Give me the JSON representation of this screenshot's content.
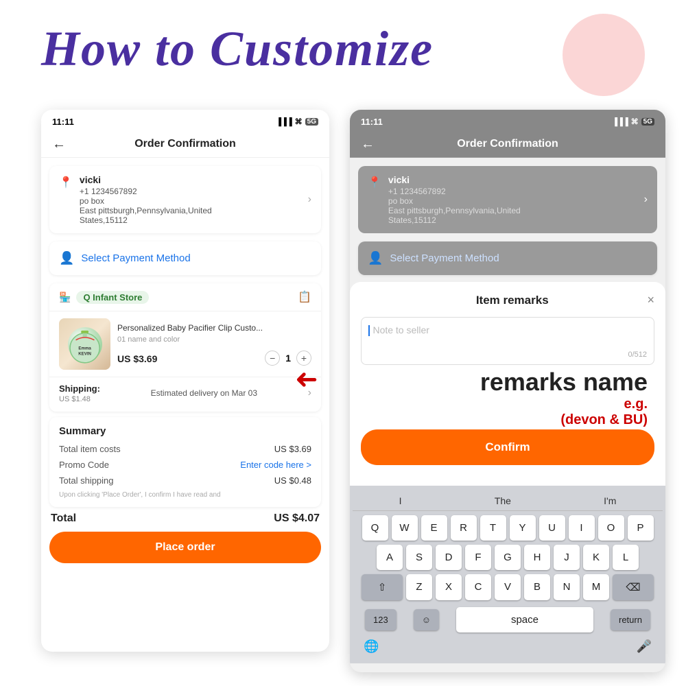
{
  "title": "How to Customize",
  "decorations": {
    "circle_pink": "pink circle",
    "circle_green": "green circle"
  },
  "left_phone": {
    "status_bar": {
      "time": "11:11",
      "signal": "signal-icon",
      "wifi": "wifi-icon",
      "network": "5G"
    },
    "header": {
      "back_label": "←",
      "title": "Order Confirmation"
    },
    "address": {
      "name": "vicki",
      "phone": "+1 1234567892",
      "address1": "po box",
      "address2": "East pittsburgh,Pennsylvania,United",
      "address3": "States,15112"
    },
    "payment": {
      "label": "Select Payment Method"
    },
    "store": {
      "name": "Q Infant Store"
    },
    "product": {
      "title": "Personalized Baby Pacifier Clip Custo...",
      "variant": "01 name and color",
      "price": "US $3.69",
      "quantity": "1"
    },
    "shipping": {
      "label": "Shipping:",
      "cost": "US $1.48",
      "delivery": "Estimated delivery on Mar 03"
    },
    "summary": {
      "title": "Summary",
      "item_costs_label": "Total item costs",
      "item_costs_value": "US $3.69",
      "promo_label": "Promo Code",
      "promo_value": "Enter code here >",
      "shipping_label": "Total shipping",
      "shipping_value": "US $0.48",
      "disclaimer": "Upon clicking 'Place Order', I confirm I have read and"
    },
    "total": {
      "label": "Total",
      "value": "US $4.07"
    },
    "place_order": "Place order"
  },
  "right_phone": {
    "status_bar": {
      "time": "11:11",
      "signal": "signal-icon",
      "wifi": "wifi-icon",
      "network": "5G"
    },
    "header": {
      "back_label": "←",
      "title": "Order Confirmation"
    },
    "address": {
      "name": "vicki",
      "phone": "+1 1234567892",
      "address1": "po box",
      "address2": "East pittsburgh,Pennsylvania,United",
      "address3": "States,15112"
    },
    "payment_partial": "Select Payment Method",
    "modal": {
      "title": "Item remarks",
      "close": "×",
      "placeholder": "Note to seller",
      "char_count": "0/512",
      "confirm_btn": "Confirm"
    },
    "annotation": {
      "line1": "remarks name",
      "line2": "e.g.",
      "line3": "(devon & BU)"
    },
    "keyboard": {
      "suggestions": [
        "I",
        "The",
        "I'm"
      ],
      "row1": [
        "Q",
        "W",
        "E",
        "R",
        "T",
        "Y",
        "U",
        "I",
        "O",
        "P"
      ],
      "row2": [
        "A",
        "S",
        "D",
        "F",
        "G",
        "H",
        "J",
        "K",
        "L"
      ],
      "row3": [
        "Z",
        "X",
        "C",
        "V",
        "B",
        "N",
        "M"
      ],
      "shift": "⇧",
      "delete": "⌫",
      "numbers": "123",
      "emoji": "☺",
      "space": "space",
      "return": "return",
      "globe": "🌐",
      "mic": "🎤"
    }
  },
  "arrow": "→"
}
